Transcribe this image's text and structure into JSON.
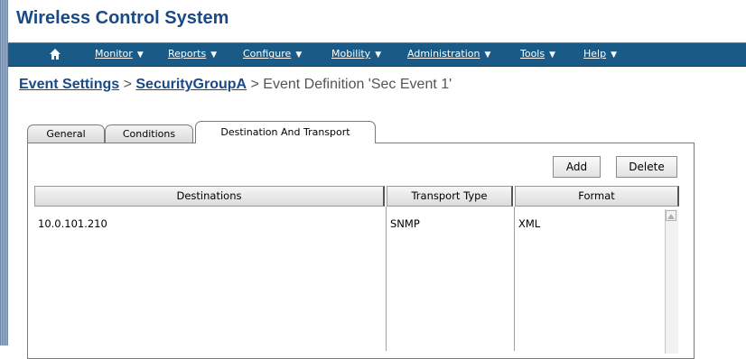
{
  "app": {
    "title": "Wireless Control System"
  },
  "nav": {
    "home_icon": "home-icon",
    "items": [
      {
        "label": "Monitor",
        "name": "nav-monitor"
      },
      {
        "label": "Reports",
        "name": "nav-reports"
      },
      {
        "label": "Configure",
        "name": "nav-configure"
      },
      {
        "label": "Mobility",
        "name": "nav-mobility"
      },
      {
        "label": "Administration",
        "name": "nav-administration"
      },
      {
        "label": "Tools",
        "name": "nav-tools"
      },
      {
        "label": "Help",
        "name": "nav-help"
      }
    ],
    "caret": "▼"
  },
  "breadcrumb": {
    "link1": "Event Settings",
    "sep1": " > ",
    "link2": "SecurityGroupA",
    "sep2": " > ",
    "current": "Event Definition 'Sec Event 1'"
  },
  "tabs": [
    {
      "label": "General"
    },
    {
      "label": "Conditions"
    },
    {
      "label": "Destination And Transport",
      "active": true
    }
  ],
  "toolbar": {
    "add_label": "Add",
    "delete_label": "Delete"
  },
  "table": {
    "columns": [
      "Destinations",
      "Transport Type",
      "Format"
    ],
    "rows": [
      {
        "destination": "10.0.101.210",
        "transport": "SNMP",
        "format": "XML"
      }
    ]
  },
  "colors": {
    "title": "#1a4a86",
    "navbar": "#1a5a86",
    "link": "#1a4a86"
  }
}
